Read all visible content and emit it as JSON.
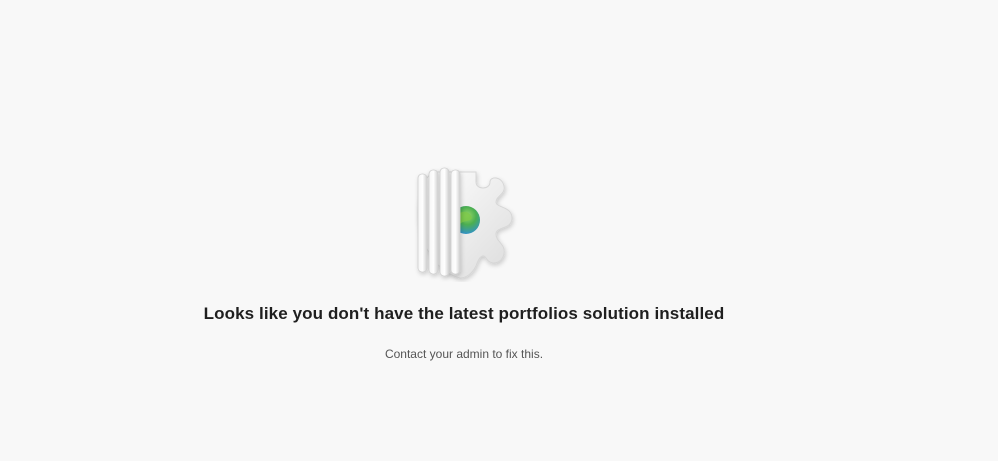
{
  "empty_state": {
    "illustration_icon": "shield-puzzle-globe-icon",
    "headline": "Looks like you don't have the latest portfolios solution installed",
    "message": "Contact your admin to fix this."
  },
  "colors": {
    "background": "#f8f8f8",
    "headline": "#1f1f1f",
    "message": "#555555",
    "globe_green": "#4caf50",
    "globe_blue": "#2f8fd8"
  }
}
